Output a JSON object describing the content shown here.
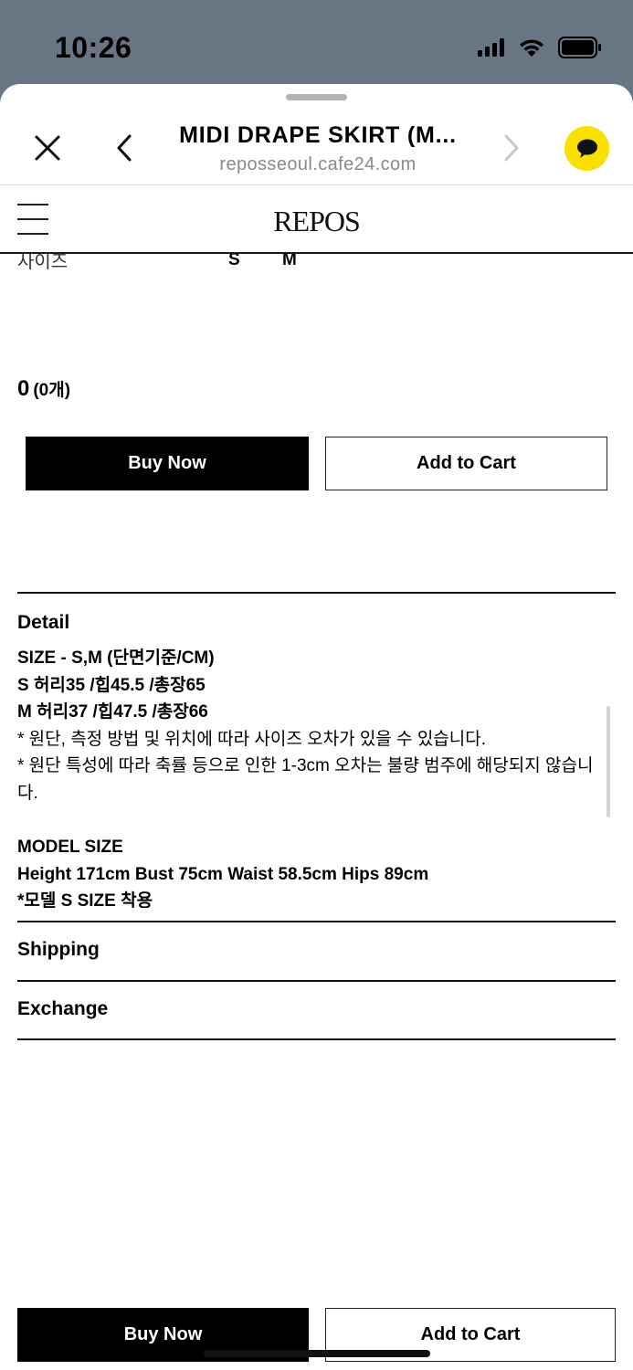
{
  "status_bar": {
    "time": "10:26",
    "icons": [
      "cellular-signal-icon",
      "wifi-icon",
      "battery-icon"
    ]
  },
  "browser": {
    "title": "MIDI DRAPE SKIRT (M...",
    "url": "reposseoul.cafe24.com",
    "icons": [
      "close-icon",
      "back-icon",
      "forward-icon",
      "kakao-chat-icon"
    ],
    "chat_color": "#F9E000"
  },
  "site": {
    "logo": "REPOS",
    "menu_icon": "hamburger-menu-icon"
  },
  "product": {
    "size_label": "사이즈",
    "size_options": [
      "S",
      "M"
    ],
    "total_price": "0",
    "total_count": "(0개)"
  },
  "actions": {
    "buy_now": "Buy Now",
    "add_to_cart": "Add to Cart"
  },
  "detail": {
    "heading": "Detail",
    "lines": [
      "SIZE - S,M (단면기준/CM)",
      "S 허리35 /힙45.5 /총장65",
      "M 허리37 /힙47.5 /총장66",
      "* 원단, 측정 방법 및 위치에 따라 사이즈 오차가 있을 수 있습니다.",
      "* 원단 특성에 따라 축률 등으로 인한 1-3cm 오차는 불량 범주에 해당되지 않습니다."
    ],
    "model_heading": "MODEL SIZE",
    "model_lines": [
      "Height 171cm  Bust 75cm Waist 58.5cm Hips 89cm",
      "*모델 S SIZE 착용"
    ]
  },
  "sections": {
    "shipping": "Shipping",
    "exchange": "Exchange"
  },
  "colors": {
    "primary_button": "#000000",
    "chat_button": "#F9E000",
    "status_bar_bg": "#687684"
  }
}
